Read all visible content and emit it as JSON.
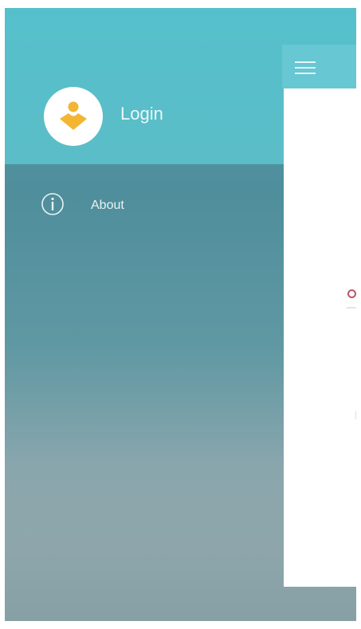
{
  "drawer": {
    "header": {
      "login_label": "Login",
      "avatar_icon": "user-icon",
      "avatar_color": "#f2b632",
      "background_color": "#5bbdc7"
    },
    "items": [
      {
        "label": "About",
        "icon": "info-icon"
      }
    ]
  },
  "toolbar": {
    "menu_icon": "menu-icon",
    "background_color": "#67c7d2"
  }
}
